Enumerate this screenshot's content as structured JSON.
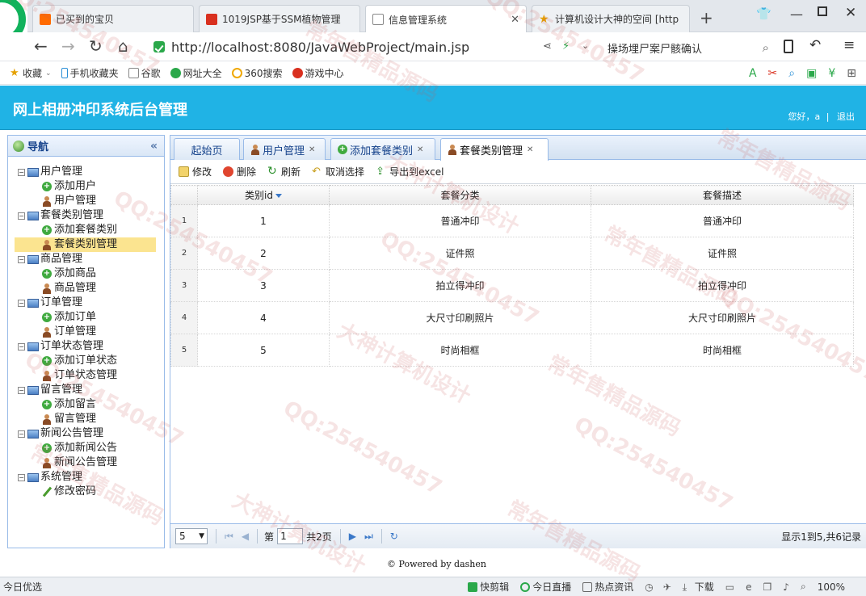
{
  "browser": {
    "tabs": [
      {
        "title": "已买到的宝贝",
        "active": false
      },
      {
        "title": "1019JSP基于SSM植物管理",
        "active": false
      },
      {
        "title": "信息管理系统",
        "active": true
      },
      {
        "title": "计算机设计大神的空间 [http",
        "active": false
      }
    ],
    "new_tab": "+",
    "url": "http://localhost:8080/JavaWebProject/main.jsp",
    "search_text": "操场埋尸案尸骸确认",
    "bookmarks": [
      "收藏",
      "手机收藏夹",
      "谷歌",
      "网址大全",
      "360搜索",
      "游戏中心"
    ],
    "status": {
      "left": "今日优选",
      "items": [
        "快剪辑",
        "今日直播",
        "热点资讯",
        "下载"
      ],
      "zoom": "100%"
    }
  },
  "app": {
    "title": "网上相册冲印系统后台管理",
    "greeting": "您好，a",
    "logout": "退出",
    "footer": "Powered by dashen"
  },
  "sidebar": {
    "title": "导航",
    "collapse": "«",
    "groups": [
      {
        "label": "用户管理",
        "items": [
          {
            "label": "添加用户",
            "icon": "add-icon"
          },
          {
            "label": "用户管理",
            "icon": "user-icon"
          }
        ]
      },
      {
        "label": "套餐类别管理",
        "items": [
          {
            "label": "添加套餐类别",
            "icon": "add-icon"
          },
          {
            "label": "套餐类别管理",
            "icon": "user-icon",
            "selected": true
          }
        ]
      },
      {
        "label": "商品管理",
        "items": [
          {
            "label": "添加商品",
            "icon": "add-icon"
          },
          {
            "label": "商品管理",
            "icon": "user-icon"
          }
        ]
      },
      {
        "label": "订单管理",
        "items": [
          {
            "label": "添加订单",
            "icon": "add-icon"
          },
          {
            "label": "订单管理",
            "icon": "user-icon"
          }
        ]
      },
      {
        "label": "订单状态管理",
        "items": [
          {
            "label": "添加订单状态",
            "icon": "add-icon"
          },
          {
            "label": "订单状态管理",
            "icon": "user-icon"
          }
        ]
      },
      {
        "label": "留言管理",
        "items": [
          {
            "label": "添加留言",
            "icon": "add-icon"
          },
          {
            "label": "留言管理",
            "icon": "user-icon"
          }
        ]
      },
      {
        "label": "新闻公告管理",
        "items": [
          {
            "label": "添加新闻公告",
            "icon": "add-icon"
          },
          {
            "label": "新闻公告管理",
            "icon": "user-icon"
          }
        ]
      },
      {
        "label": "系统管理",
        "items": [
          {
            "label": "修改密码",
            "icon": "pencil-icon"
          }
        ]
      }
    ]
  },
  "panel_tabs": [
    {
      "label": "起始页",
      "closable": false,
      "icon": ""
    },
    {
      "label": "用户管理",
      "closable": true,
      "icon": "user-icon"
    },
    {
      "label": "添加套餐类别",
      "closable": true,
      "icon": "add-icon"
    },
    {
      "label": "套餐类别管理",
      "closable": true,
      "icon": "user-icon",
      "active": true
    }
  ],
  "toolbar": {
    "edit": "修改",
    "delete": "删除",
    "refresh": "刷新",
    "cancel_select": "取消选择",
    "export": "导出到excel"
  },
  "grid": {
    "columns": [
      "类别id",
      "套餐分类",
      "套餐描述"
    ],
    "rows": [
      {
        "num": "1",
        "id": "1",
        "cat": "普通冲印",
        "desc": "普通冲印"
      },
      {
        "num": "2",
        "id": "2",
        "cat": "证件照",
        "desc": "证件照"
      },
      {
        "num": "3",
        "id": "3",
        "cat": "拍立得冲印",
        "desc": "拍立得冲印"
      },
      {
        "num": "4",
        "id": "4",
        "cat": "大尺寸印刷照片",
        "desc": "大尺寸印刷照片"
      },
      {
        "num": "5",
        "id": "5",
        "cat": "时尚相框",
        "desc": "时尚相框"
      }
    ]
  },
  "pager": {
    "page_size": "5",
    "page_prefix": "第",
    "page": "1",
    "page_suffix": "共2页",
    "info": "显示1到5,共6记录"
  },
  "watermarks": [
    "QQ:254540457",
    "大神计算机设计",
    "常年售精品源码"
  ],
  "colors": {
    "header": "#20b3e5",
    "panel_border": "#99bbe8",
    "selected": "#fbe490"
  }
}
